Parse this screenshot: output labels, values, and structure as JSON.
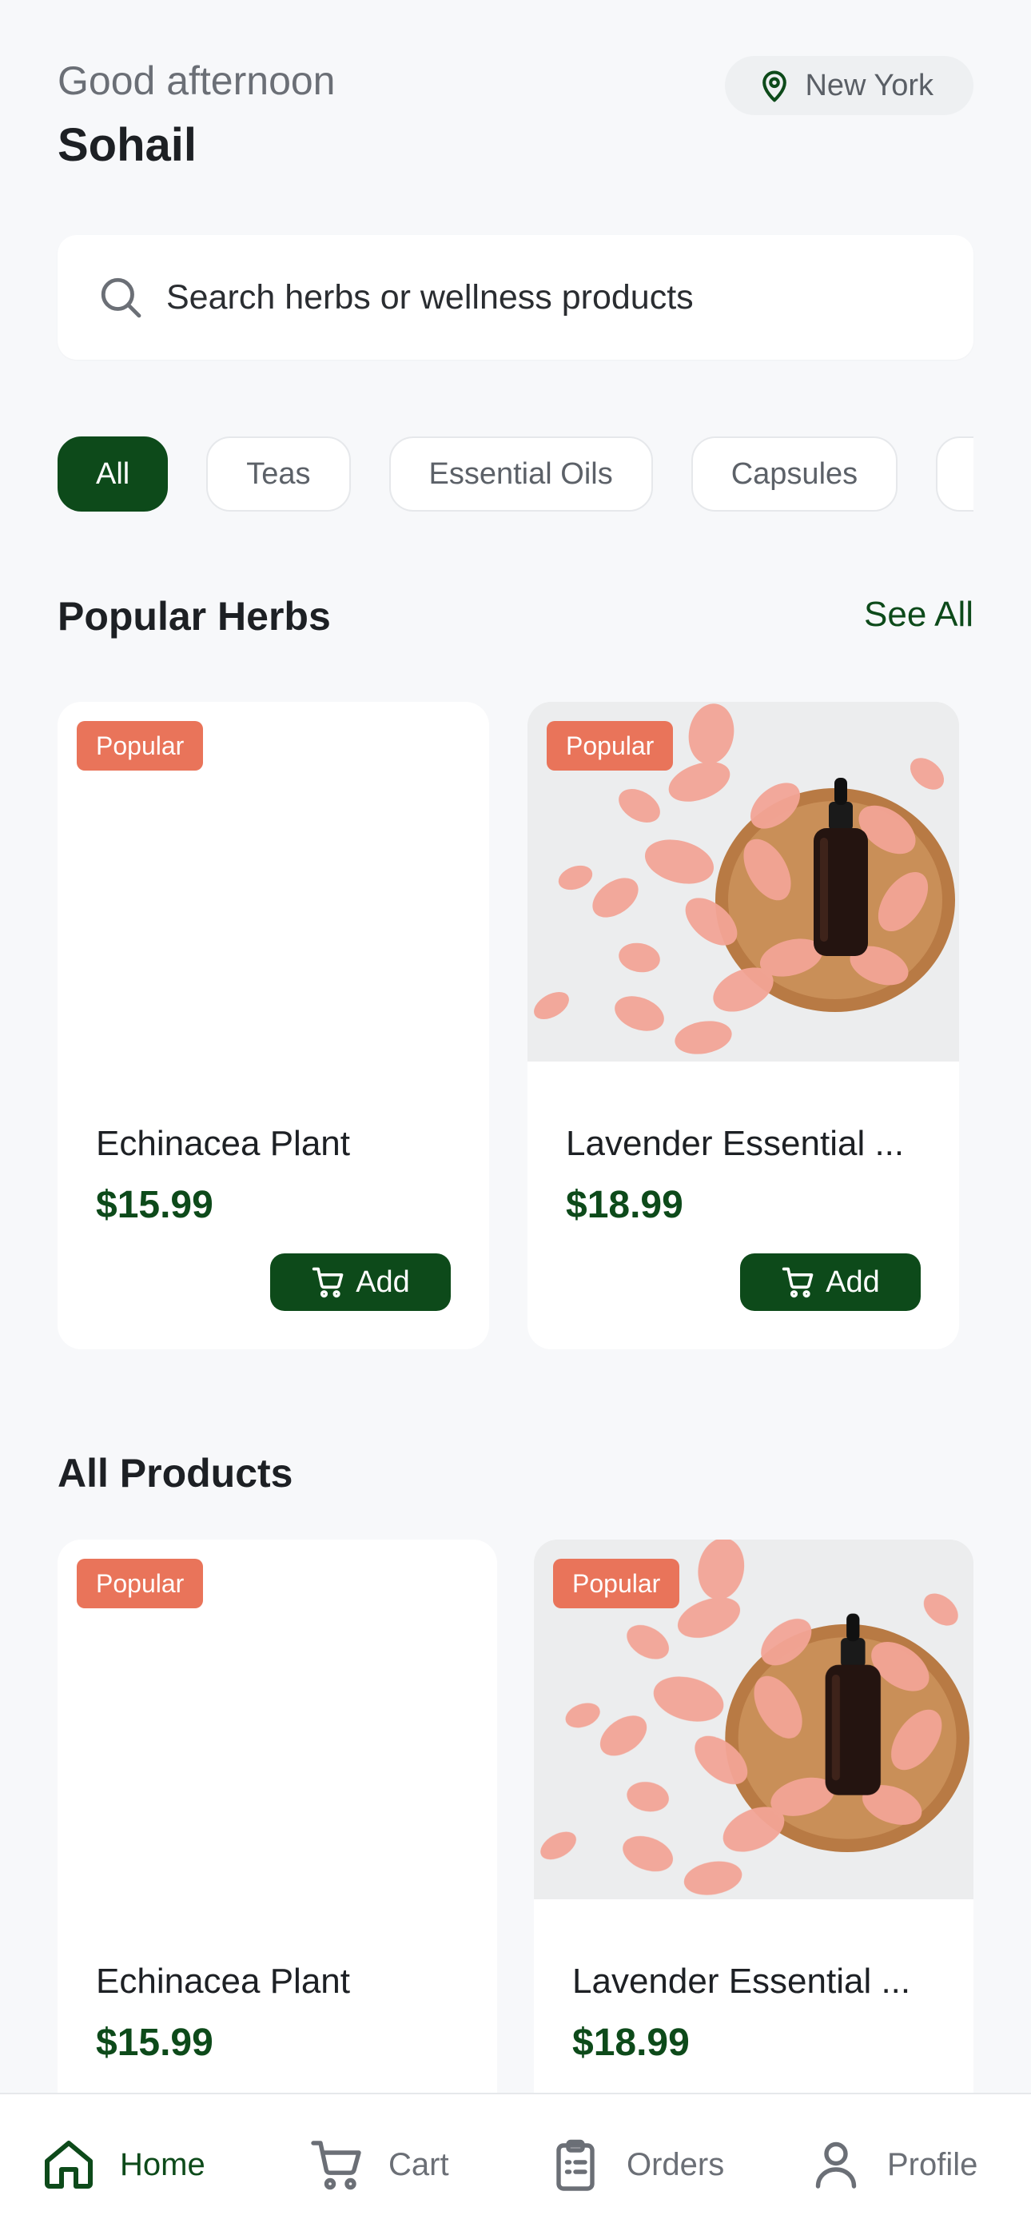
{
  "header": {
    "greeting": "Good afternoon",
    "username": "Sohail",
    "location": "New York"
  },
  "search": {
    "placeholder": "Search herbs or wellness products"
  },
  "categories": [
    "All",
    "Teas",
    "Essential Oils",
    "Capsules"
  ],
  "popular_section": {
    "title": "Popular Herbs",
    "see_all": "See All"
  },
  "all_products_section": {
    "title": "All Products"
  },
  "popular_products": [
    {
      "badge": "Popular",
      "name": "Echinacea Plant",
      "price": "$15.99",
      "add_label": "Add",
      "image": "none"
    },
    {
      "badge": "Popular",
      "name": "Lavender Essential ...",
      "price": "$18.99",
      "add_label": "Add",
      "image": "dropper-bottle-rose-petals"
    }
  ],
  "all_products": [
    {
      "badge": "Popular",
      "name": "Echinacea Plant",
      "price": "$15.99",
      "image": "none"
    },
    {
      "badge": "Popular",
      "name": "Lavender Essential ...",
      "price": "$18.99",
      "image": "dropper-bottle-rose-petals"
    }
  ],
  "bottom_nav": [
    {
      "label": "Home",
      "icon": "home-icon",
      "active": true
    },
    {
      "label": "Cart",
      "icon": "cart-icon",
      "active": false
    },
    {
      "label": "Orders",
      "icon": "clipboard-icon",
      "active": false
    },
    {
      "label": "Profile",
      "icon": "profile-icon",
      "active": false
    }
  ],
  "colors": {
    "brand_green": "#0d4a1a",
    "badge": "#e9745a",
    "background": "#f7f8fa"
  }
}
